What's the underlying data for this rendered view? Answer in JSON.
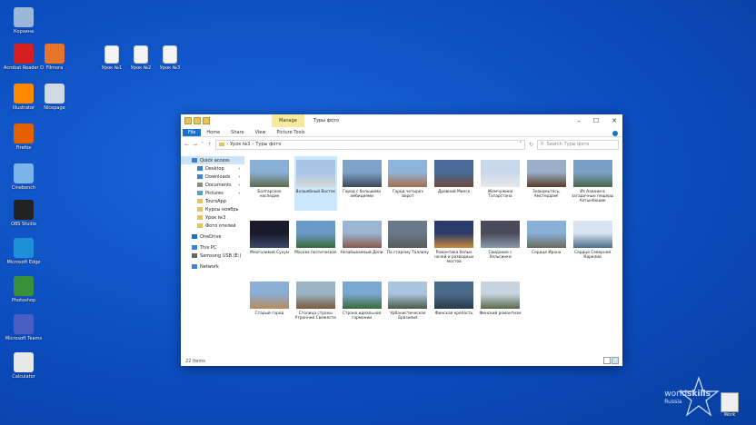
{
  "desktop": {
    "left_icons": [
      {
        "label": "Корзина",
        "icon": "recycle-bin",
        "color": "#9bb8d8"
      },
      {
        "label": "Acrobat Reader DC",
        "icon": "acrobat",
        "color": "#d42020"
      },
      {
        "label": "Filmora",
        "icon": "filmora",
        "color": "#e8742c"
      },
      {
        "label": "Illustrator",
        "icon": "illustrator",
        "color": "#ff8a00"
      },
      {
        "label": "Nicepage",
        "icon": "nicepage",
        "color": "#cfd8e3"
      },
      {
        "label": "Firefox",
        "icon": "firefox",
        "color": "#e66000"
      },
      {
        "label": "Cinebench",
        "icon": "cinebench",
        "color": "#7ab4e8"
      },
      {
        "label": "OBS Studio",
        "icon": "obs",
        "color": "#222222"
      },
      {
        "label": "Microsoft Edge",
        "icon": "edge",
        "color": "#1e90d8"
      },
      {
        "label": "Photoshop",
        "icon": "photoshop",
        "color": "#3a8f3a"
      },
      {
        "label": "Microsoft Teams",
        "icon": "teams",
        "color": "#4a5fc4"
      },
      {
        "label": "Calculator",
        "icon": "calculator",
        "color": "#e8e8e8"
      }
    ],
    "file_icons": [
      {
        "label": "Урок №1"
      },
      {
        "label": "Урок №2"
      },
      {
        "label": "Урок №3"
      }
    ],
    "brand": {
      "text_a": "world",
      "text_b": "skills",
      "sub": "Russia"
    },
    "work_icon_label": "Work"
  },
  "explorer": {
    "context_tab": "Manage",
    "title": "Туры фото",
    "ribbon_tabs": [
      "File",
      "Home",
      "Share",
      "View",
      "Picture Tools"
    ],
    "path": [
      "Урок №3",
      "Туры фото"
    ],
    "search_placeholder": "Search Туры фото",
    "sidebar": [
      {
        "label": "Quick access",
        "icon": "star-icon",
        "sel": true,
        "sub": false,
        "color": "#3b82d6"
      },
      {
        "label": "Desktop",
        "icon": "desktop-icon",
        "sub": true,
        "pin": true,
        "color": "#3b82d6"
      },
      {
        "label": "Downloads",
        "icon": "download-icon",
        "sub": true,
        "pin": true,
        "color": "#3b82d6"
      },
      {
        "label": "Documents",
        "icon": "documents-icon",
        "sub": true,
        "pin": true,
        "color": "#8a8a8a"
      },
      {
        "label": "Pictures",
        "icon": "pictures-icon",
        "sub": true,
        "pin": true,
        "color": "#5aa0d8"
      },
      {
        "label": "ToursApp",
        "icon": "folder-icon",
        "sub": true,
        "color": "#e8c25a"
      },
      {
        "label": "Курсы ноябрь",
        "icon": "folder-icon",
        "sub": true,
        "color": "#e8c25a"
      },
      {
        "label": "Урок №3",
        "icon": "folder-icon",
        "sub": true,
        "color": "#e8c25a"
      },
      {
        "label": "Фото отелей",
        "icon": "folder-icon",
        "sub": true,
        "color": "#e8c25a"
      },
      {
        "label": "OneDrive",
        "icon": "cloud-icon",
        "sub": false,
        "color": "#1a73c8"
      },
      {
        "label": "This PC",
        "icon": "pc-icon",
        "sub": false,
        "color": "#3b82d6"
      },
      {
        "label": "Samsung USB (E:)",
        "icon": "usb-icon",
        "sub": false,
        "color": "#666666"
      },
      {
        "label": "Network",
        "icon": "network-icon",
        "sub": false,
        "color": "#3b82d6"
      }
    ],
    "photos": [
      {
        "caption": "Болгарское наследие",
        "colors": [
          "#8bb0d8",
          "#5c6b4a"
        ]
      },
      {
        "caption": "Волшебный Восток",
        "colors": [
          "#a9c4e4",
          "#d8d8d8"
        ],
        "sel": true
      },
      {
        "caption": "Город с большими амбициями",
        "colors": [
          "#7fa2c9",
          "#3b4a5a"
        ]
      },
      {
        "caption": "Город четырех ворот",
        "colors": [
          "#8fb4dc",
          "#a6704a"
        ]
      },
      {
        "caption": "Древний Минск",
        "colors": [
          "#4a6a9a",
          "#6a4a3a"
        ]
      },
      {
        "caption": "Жемчужина Татарстана",
        "colors": [
          "#c8d8ea",
          "#e8e8e8"
        ]
      },
      {
        "caption": "Знакомьтесь, Амстердам!",
        "colors": [
          "#9ab0c8",
          "#5a3a2a"
        ]
      },
      {
        "caption": "Из Алании в загадочные пещеры Алтынбешик",
        "colors": [
          "#7aa0c8",
          "#4a6a4a"
        ]
      },
      {
        "caption": "Многоликий Сухум",
        "colors": [
          "#1a1a2a",
          "#3a4a6a"
        ]
      },
      {
        "caption": "Москва поэтическая",
        "colors": [
          "#6a9ac8",
          "#3a6a3a"
        ]
      },
      {
        "caption": "Незабываемый Дели",
        "colors": [
          "#9ab4d4",
          "#8a5a4a"
        ]
      },
      {
        "caption": "По старому Таллину",
        "colors": [
          "#6a7a8a",
          "#5a5a5a"
        ]
      },
      {
        "caption": "Романтика белых ночей и разводных мостов",
        "colors": [
          "#2a3a6a",
          "#c88a3a"
        ]
      },
      {
        "caption": "Свидание с Хельсинки",
        "colors": [
          "#4a4a5a",
          "#8a9aaa"
        ]
      },
      {
        "caption": "Сердце Ирана",
        "colors": [
          "#8ab0d8",
          "#6a6a5a"
        ]
      },
      {
        "caption": "Сердце Северной Карелии",
        "colors": [
          "#d8e4f0",
          "#4a6a8a"
        ]
      },
      {
        "caption": "Старый город",
        "colors": [
          "#8aaed4",
          "#b88a5a"
        ]
      },
      {
        "caption": "Столица страны Утренней Свежести",
        "colors": [
          "#9ab4c4",
          "#7a5a3a"
        ]
      },
      {
        "caption": "Страна идеальной гармонии",
        "colors": [
          "#7aa8d0",
          "#3a6a3a"
        ]
      },
      {
        "caption": "Урбанистическая Бразилия",
        "colors": [
          "#aac4de",
          "#4a5a4a"
        ]
      },
      {
        "caption": "Финская крепость",
        "colors": [
          "#4a6a8a",
          "#2a3a4a"
        ]
      },
      {
        "caption": "Финский романтизм",
        "colors": [
          "#c8d4e0",
          "#5a6a4a"
        ]
      }
    ],
    "status": "22 items"
  }
}
